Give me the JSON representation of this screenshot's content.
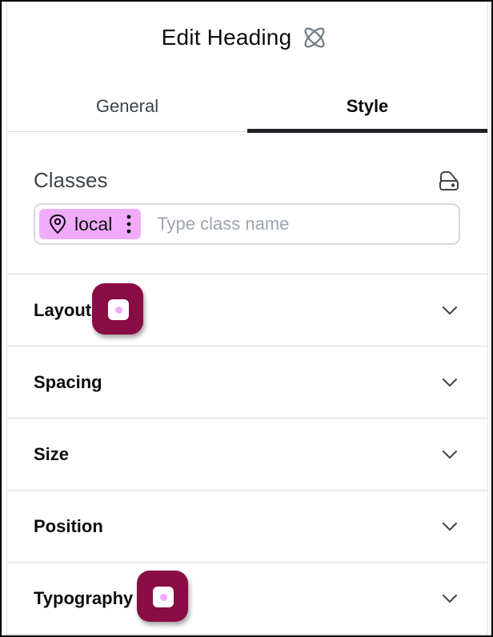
{
  "header": {
    "title": "Edit Heading",
    "icon": "atom-icon"
  },
  "tabs": [
    {
      "label": "General",
      "active": false
    },
    {
      "label": "Style",
      "active": true
    }
  ],
  "classes": {
    "label": "Classes",
    "manager_icon": "database-icon",
    "chip": {
      "label": "local",
      "icon": "map-pin-icon",
      "color": "#f0abfc"
    },
    "input_placeholder": "Type class name",
    "input_value": ""
  },
  "sections": [
    {
      "label": "Layout",
      "expanded": false
    },
    {
      "label": "Spacing",
      "expanded": false
    },
    {
      "label": "Size",
      "expanded": false
    },
    {
      "label": "Position",
      "expanded": false
    },
    {
      "label": "Typography",
      "expanded": false
    }
  ],
  "colors": {
    "marker": "#8a0c44",
    "chip": "#f0abfc",
    "active_tab_underline": "#1f2124"
  }
}
